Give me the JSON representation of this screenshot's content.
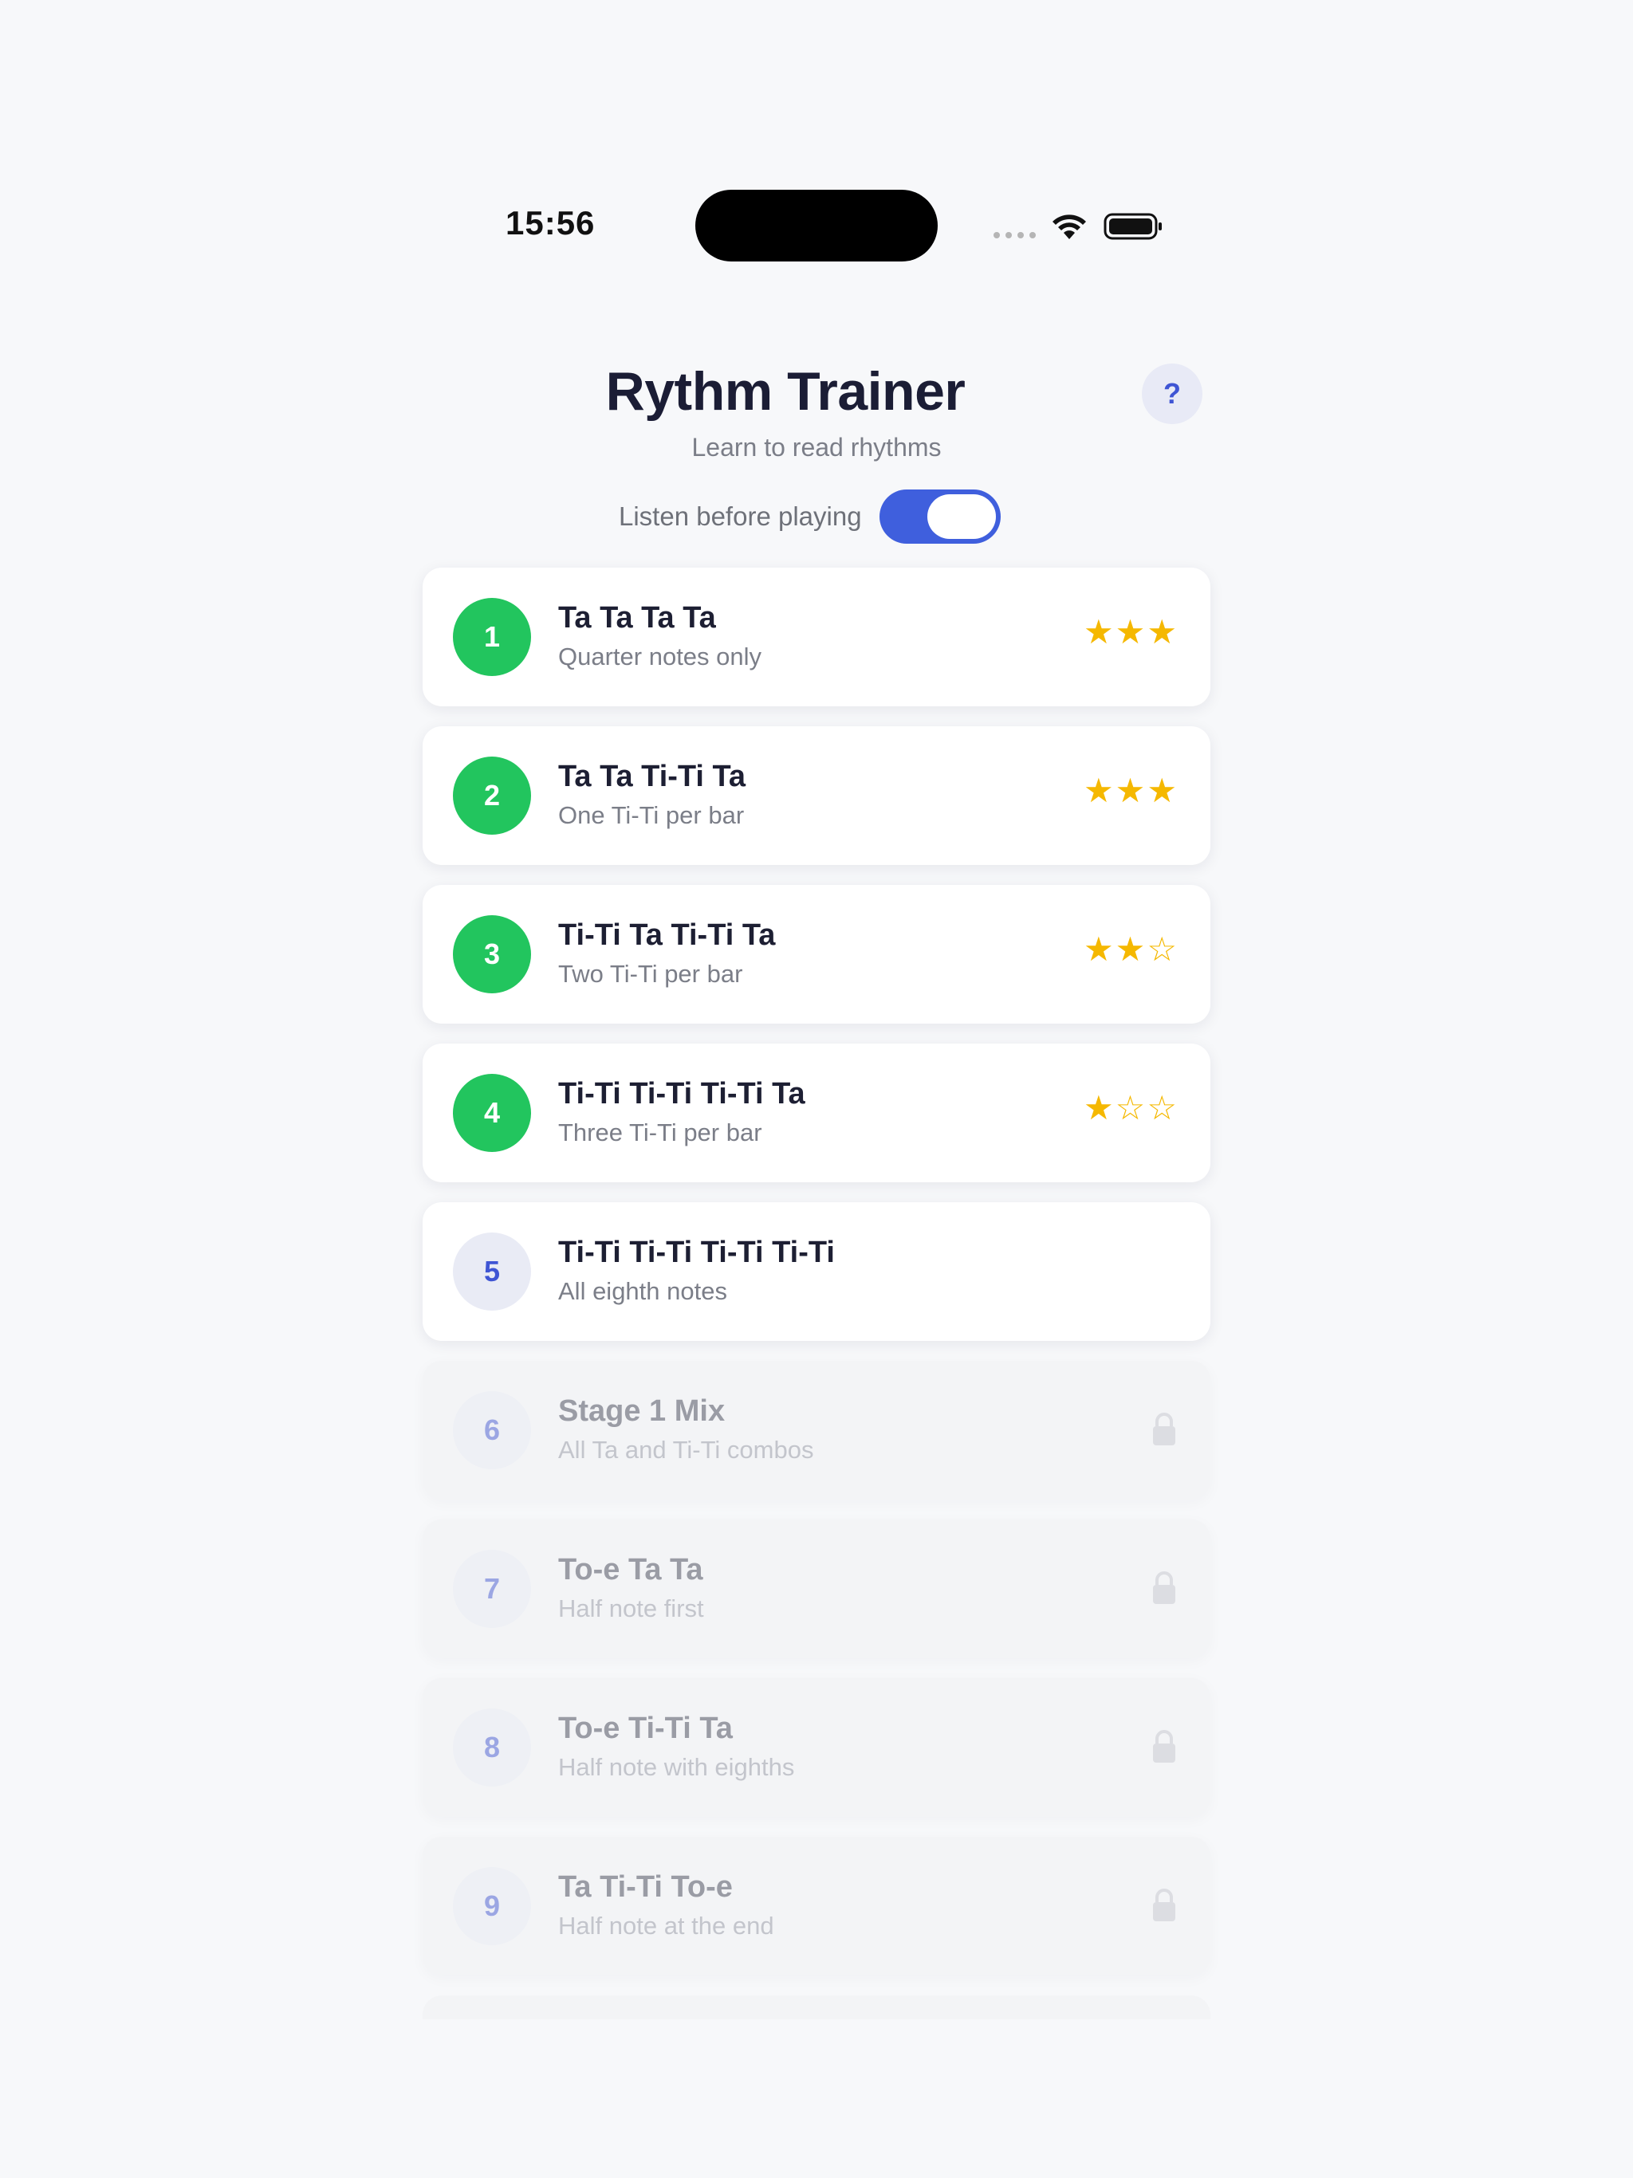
{
  "status_bar": {
    "time": "15:56"
  },
  "header": {
    "title": "Rythm Trainer",
    "subtitle": "Learn to read rhythms",
    "help_label": "?",
    "listen_label": "Listen before playing",
    "listen_enabled": true
  },
  "colors": {
    "accent": "#3f5fdd",
    "completed": "#22c55e",
    "star": "#f5b800"
  },
  "lessons": [
    {
      "number": "1",
      "title": "Ta Ta Ta Ta",
      "subtitle": "Quarter notes only",
      "stars": "★★★",
      "rating": 3,
      "state": "completed"
    },
    {
      "number": "2",
      "title": "Ta Ta Ti-Ti Ta",
      "subtitle": "One Ti-Ti per bar",
      "stars": "★★★",
      "rating": 3,
      "state": "completed"
    },
    {
      "number": "3",
      "title": "Ti-Ti Ta Ti-Ti Ta",
      "subtitle": "Two Ti-Ti per bar",
      "stars": "★★☆",
      "rating": 2,
      "state": "completed"
    },
    {
      "number": "4",
      "title": "Ti-Ti Ti-Ti Ti-Ti Ta",
      "subtitle": "Three Ti-Ti per bar",
      "stars": "★☆☆",
      "rating": 1,
      "state": "completed"
    },
    {
      "number": "5",
      "title": "Ti-Ti Ti-Ti Ti-Ti Ti-Ti",
      "subtitle": "All eighth notes",
      "state": "current"
    },
    {
      "number": "6",
      "title": "Stage 1 Mix",
      "subtitle": "All Ta and Ti-Ti combos",
      "state": "locked",
      "icon": "lock-icon"
    },
    {
      "number": "7",
      "title": "To-e Ta Ta",
      "subtitle": "Half note first",
      "state": "locked",
      "icon": "lock-icon"
    },
    {
      "number": "8",
      "title": "To-e Ti-Ti Ta",
      "subtitle": "Half note with eighths",
      "state": "locked",
      "icon": "lock-icon"
    },
    {
      "number": "9",
      "title": "Ta Ti-Ti To-e",
      "subtitle": "Half note at the end",
      "state": "locked",
      "icon": "lock-icon"
    }
  ]
}
